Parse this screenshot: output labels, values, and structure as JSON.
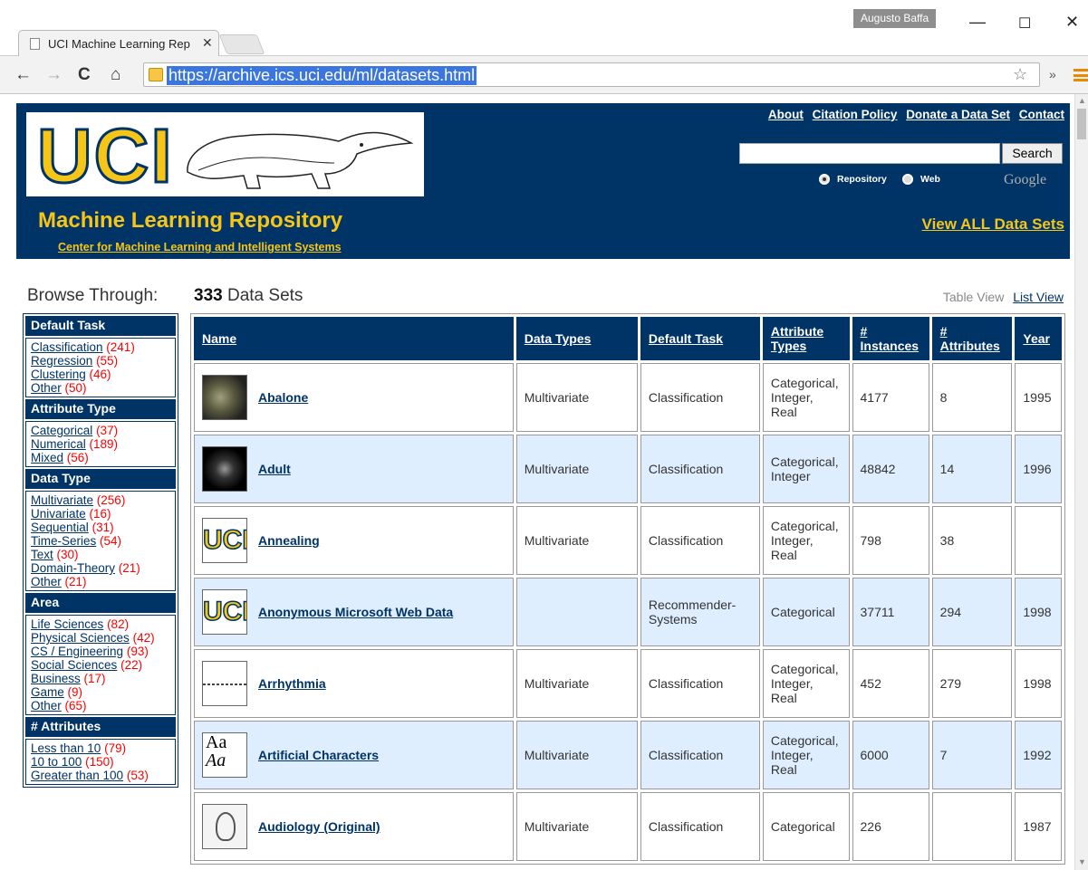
{
  "browser": {
    "tab_title": "UCI Machine Learning Rep",
    "profile_name": "Augusto Baffa",
    "url": "https://archive.ics.uci.edu/ml/datasets.html"
  },
  "header": {
    "logo_text": "UCI",
    "site_title": "Machine Learning Repository",
    "site_subtitle": "Center for Machine Learning and Intelligent Systems",
    "links": [
      "About",
      "Citation Policy",
      "Donate a Data Set",
      "Contact"
    ],
    "search_button": "Search",
    "radio_repository": "Repository",
    "radio_web": "Web",
    "google_label": "Google",
    "view_all": "View ALL Data Sets"
  },
  "browse": {
    "heading": "Browse Through:",
    "count": "333",
    "count_label": "Data Sets",
    "table_view": "Table View",
    "list_view": "List View"
  },
  "sidebar": [
    {
      "title": "Default Task",
      "items": [
        {
          "label": "Classification",
          "count": "(241)"
        },
        {
          "label": "Regression",
          "count": "(55)"
        },
        {
          "label": "Clustering",
          "count": "(46)"
        },
        {
          "label": "Other",
          "count": "(50)"
        }
      ]
    },
    {
      "title": "Attribute Type",
      "items": [
        {
          "label": "Categorical",
          "count": "(37)"
        },
        {
          "label": "Numerical",
          "count": "(189)"
        },
        {
          "label": "Mixed",
          "count": "(56)"
        }
      ]
    },
    {
      "title": "Data Type",
      "items": [
        {
          "label": "Multivariate",
          "count": "(256)"
        },
        {
          "label": "Univariate",
          "count": "(16)"
        },
        {
          "label": "Sequential",
          "count": "(31)"
        },
        {
          "label": "Time-Series",
          "count": "(54)"
        },
        {
          "label": "Text",
          "count": "(30)"
        },
        {
          "label": "Domain-Theory",
          "count": "(21)"
        },
        {
          "label": "Other",
          "count": "(21)"
        }
      ]
    },
    {
      "title": "Area",
      "items": [
        {
          "label": "Life Sciences",
          "count": "(82)"
        },
        {
          "label": "Physical Sciences",
          "count": "(42)"
        },
        {
          "label": "CS / Engineering",
          "count": "(93)"
        },
        {
          "label": "Social Sciences",
          "count": "(22)"
        },
        {
          "label": "Business",
          "count": "(17)"
        },
        {
          "label": "Game",
          "count": "(9)"
        },
        {
          "label": "Other",
          "count": "(65)"
        }
      ]
    },
    {
      "title": "# Attributes",
      "items": [
        {
          "label": "Less than 10",
          "count": "(79)"
        },
        {
          "label": "10 to 100",
          "count": "(150)"
        },
        {
          "label": "Greater than 100",
          "count": "(53)"
        }
      ]
    }
  ],
  "table": {
    "headers": [
      "Name",
      "Data Types",
      "Default Task",
      "Attribute Types",
      "# Instances",
      "# Attributes",
      "Year"
    ],
    "rows": [
      {
        "thumb": "dark",
        "name": "Abalone",
        "data_types": "Multivariate",
        "task": "Classification",
        "attr_types": "Categorical, Integer, Real",
        "instances": "4177",
        "attributes": "8",
        "year": "1995"
      },
      {
        "thumb": "black",
        "name": "Adult",
        "data_types": "Multivariate",
        "task": "Classification",
        "attr_types": "Categorical, Integer",
        "instances": "48842",
        "attributes": "14",
        "year": "1996"
      },
      {
        "thumb": "uci",
        "name": "Annealing",
        "data_types": "Multivariate",
        "task": "Classification",
        "attr_types": "Categorical, Integer, Real",
        "instances": "798",
        "attributes": "38",
        "year": ""
      },
      {
        "thumb": "uci",
        "name": "Anonymous Microsoft Web Data",
        "data_types": "",
        "task": "Recommender-Systems",
        "attr_types": "Categorical",
        "instances": "37711",
        "attributes": "294",
        "year": "1998"
      },
      {
        "thumb": "ecg",
        "name": "Arrhythmia",
        "data_types": "Multivariate",
        "task": "Classification",
        "attr_types": "Categorical, Integer, Real",
        "instances": "452",
        "attributes": "279",
        "year": "1998"
      },
      {
        "thumb": "aa",
        "name": "Artificial Characters",
        "data_types": "Multivariate",
        "task": "Classification",
        "attr_types": "Categorical, Integer, Real",
        "instances": "6000",
        "attributes": "7",
        "year": "1992"
      },
      {
        "thumb": "ear",
        "name": "Audiology (Original)",
        "data_types": "Multivariate",
        "task": "Classification",
        "attr_types": "Categorical",
        "instances": "226",
        "attributes": "",
        "year": "1987"
      }
    ]
  }
}
